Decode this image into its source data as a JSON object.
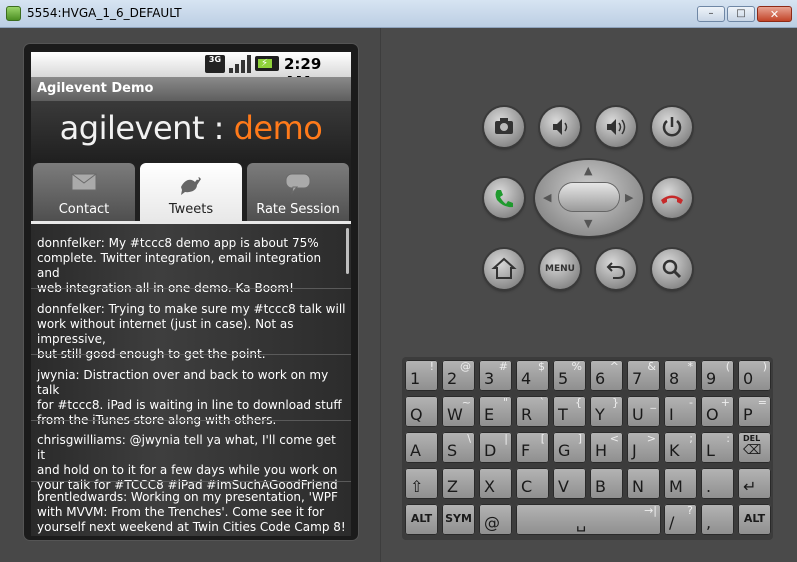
{
  "window": {
    "title": "5554:HVGA_1_6_DEFAULT",
    "min_glyph": "–",
    "max_glyph": "□",
    "close_glyph": "✕"
  },
  "status_bar": {
    "network": "3G",
    "time": "2:29 AM"
  },
  "app": {
    "title": "Agilevent Demo",
    "logo_part1": "agilevent",
    "logo_sep": " : ",
    "logo_part2": "demo"
  },
  "tabs": [
    {
      "label": "Contact",
      "icon": "envelope-icon",
      "selected": false
    },
    {
      "label": "Tweets",
      "icon": "pigeon-icon",
      "selected": true
    },
    {
      "label": "Rate Session",
      "icon": "speech-bubble-icon",
      "selected": false
    }
  ],
  "tweets": [
    {
      "line1": "donnfelker: My #tccc8 demo app is about 75%",
      "line2": "complete. Twitter integration, email integration and",
      "line3": "web integration all in one demo. Ka-Boom!"
    },
    {
      "line1": "donnfelker: Trying to make sure my #tccc8 talk will",
      "line2": "work without internet (just in case). Not as impressive,",
      "line3": "but still good enough to get the point."
    },
    {
      "line1": "jwynia: Distraction over and back to work on my talk",
      "line2": "for #tccc8.  iPad is waiting in line to download stuff",
      "line3": "from the iTunes store along with others."
    },
    {
      "line1": "chrisgwilliams: @jwynia tell ya what, I'll come get it",
      "line2": "and hold on to it for a few days while you work on",
      "line3": "your talk for #TCCC8 #iPad #ImSuchAGoodFriend"
    },
    {
      "line1": "brentledwards: Working on my presentation, 'WPF",
      "line2": "with MVVM: From the Trenches'.  Come see it for",
      "line3": "yourself next weekend at Twin Cities Code Camp 8!"
    }
  ],
  "hardware_buttons": {
    "camera": "camera-icon",
    "volume_down": "volume-down-icon",
    "volume_up": "volume-up-icon",
    "power": "power-icon",
    "call": "call-icon",
    "end_call": "end-call-icon",
    "home": "home-icon",
    "menu": "MENU",
    "back": "back-icon",
    "search": "search-icon"
  },
  "keyboard": {
    "row1": [
      {
        "m": "1",
        "a": "!"
      },
      {
        "m": "2",
        "a": "@"
      },
      {
        "m": "3",
        "a": "#"
      },
      {
        "m": "4",
        "a": "$"
      },
      {
        "m": "5",
        "a": "%"
      },
      {
        "m": "6",
        "a": "^"
      },
      {
        "m": "7",
        "a": "&"
      },
      {
        "m": "8",
        "a": "*"
      },
      {
        "m": "9",
        "a": "("
      },
      {
        "m": "0",
        "a": ")"
      }
    ],
    "row2": [
      {
        "m": "Q",
        "a": ""
      },
      {
        "m": "W",
        "a": "~"
      },
      {
        "m": "E",
        "a": "\""
      },
      {
        "m": "R",
        "a": "`"
      },
      {
        "m": "T",
        "a": "{"
      },
      {
        "m": "Y",
        "a": "}"
      },
      {
        "m": "U",
        "a": "_"
      },
      {
        "m": "I",
        "a": "-"
      },
      {
        "m": "O",
        "a": "+"
      },
      {
        "m": "P",
        "a": "="
      }
    ],
    "row3": [
      {
        "m": "A",
        "a": ""
      },
      {
        "m": "S",
        "a": "\\"
      },
      {
        "m": "D",
        "a": "|"
      },
      {
        "m": "F",
        "a": "["
      },
      {
        "m": "G",
        "a": "]"
      },
      {
        "m": "H",
        "a": "<"
      },
      {
        "m": "J",
        "a": ">"
      },
      {
        "m": "K",
        "a": ";"
      },
      {
        "m": "L",
        "a": ":"
      },
      {
        "m": "DEL",
        "a": ""
      }
    ],
    "row4": [
      {
        "m": "⇧",
        "a": ""
      },
      {
        "m": "Z",
        "a": ""
      },
      {
        "m": "X",
        "a": ""
      },
      {
        "m": "C",
        "a": ""
      },
      {
        "m": "V",
        "a": ""
      },
      {
        "m": "B",
        "a": ""
      },
      {
        "m": "N",
        "a": ""
      },
      {
        "m": "M",
        "a": ""
      },
      {
        "m": ".",
        "a": ""
      },
      {
        "m": "↵",
        "a": ""
      }
    ],
    "row5": [
      {
        "m": "ALT",
        "a": ""
      },
      {
        "m": "SYM",
        "a": ""
      },
      {
        "m": "@",
        "a": ""
      },
      {
        "m": "␣",
        "a": ""
      },
      {
        "m": "/",
        "a": "?"
      },
      {
        "m": ",",
        "a": ""
      },
      {
        "m": "ALT",
        "a": ""
      }
    ]
  }
}
